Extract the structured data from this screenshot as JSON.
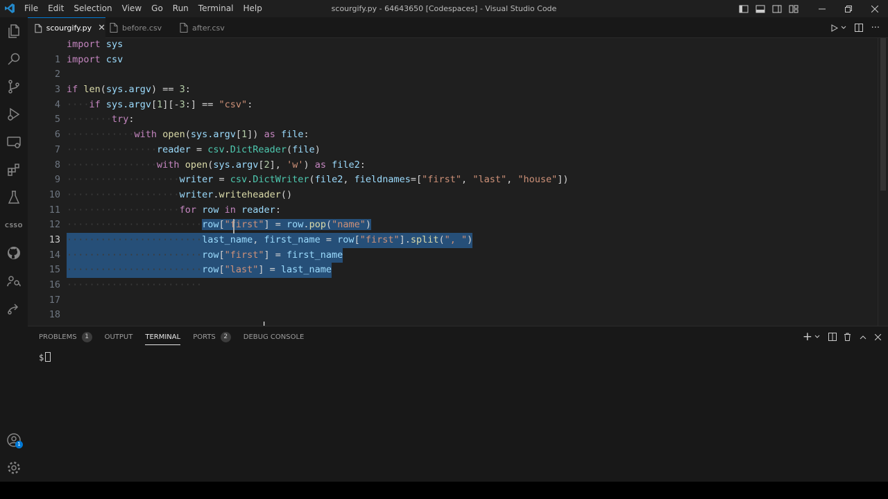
{
  "titlebar": {
    "menu": [
      "File",
      "Edit",
      "Selection",
      "View",
      "Go",
      "Run",
      "Terminal",
      "Help"
    ],
    "window_title": "scourgify.py - 64643650 [Codespaces] - Visual Studio Code"
  },
  "tabs": [
    {
      "label": "scourgify.py",
      "active": true
    },
    {
      "label": "before.csv",
      "active": false
    },
    {
      "label": "after.csv",
      "active": false
    }
  ],
  "activity": {
    "csso_label": "CSSO",
    "accounts_badge": "1"
  },
  "editor": {
    "line_numbers": [
      "1",
      "2",
      "3",
      "4",
      "5",
      "6",
      "7",
      "8",
      "9",
      "10",
      "11",
      "12",
      "13",
      "14",
      "15",
      "16",
      "17",
      "18"
    ],
    "current_line": "13",
    "lines": {
      "l1": {
        "k": "import",
        "n": "sys"
      },
      "l2": {
        "k": "import",
        "n": "csv"
      },
      "l4": {
        "k": "if",
        "f": "len",
        "o": "(",
        "n": "sys.argv",
        "c": ") ==",
        "m": "3",
        "e": ":"
      },
      "l5": {
        "ws": "····",
        "k": "if",
        "n": "sys.argv",
        "a": "[",
        "m1": "1",
        "b": "][-",
        "m2": "3",
        "c": ":] ==",
        "s": "\"csv\"",
        "e": ":"
      },
      "l6": {
        "ws": "········",
        "k": "try",
        "e": ":"
      },
      "l7": {
        "ws": "············",
        "k": "with",
        "f": "open",
        "o": "(",
        "n": "sys.argv",
        "a": "[",
        "m": "1",
        "b": "])",
        "k2": "as",
        "n2": "file",
        "e": ":"
      },
      "l8": {
        "ws": "················",
        "n": "reader",
        "o": " = ",
        "n2": "csv",
        "d": ".",
        "c": "DictReader",
        "a": "(",
        "n3": "file",
        "e": ")"
      },
      "l9": {
        "ws": "················",
        "k": "with",
        "f": "open",
        "o": "(",
        "n": "sys.argv",
        "a": "[",
        "m": "2",
        "b": "], ",
        "s": "'w'",
        "c": ")",
        "k2": "as",
        "n2": "file2",
        "e": ":"
      },
      "l10": {
        "ws": "····················",
        "n": "writer",
        "o": " = ",
        "n2": "csv",
        "d": ".",
        "c": "DictWriter",
        "a": "(",
        "n3": "file2",
        "b": ", ",
        "n4": "fieldnames",
        "eq": "=[",
        "s1": "\"first\"",
        "x1": ", ",
        "s2": "\"last\"",
        "x2": ", ",
        "s3": "\"house\"",
        "e": "])"
      },
      "l11": {
        "ws": "····················",
        "n": "writer",
        "d": ".",
        "f": "writeheader",
        "e": "()"
      },
      "l12": {
        "ws": "····················",
        "k": "for",
        "n": "row",
        "k2": "in",
        "n2": "reader",
        "e": ":"
      },
      "l13": {
        "ws": "························",
        "n": "row",
        "a": "[",
        "s": "\"first\"",
        "b": "] = ",
        "n2": "row",
        "d": ".",
        "f": "pop",
        "o": "(",
        "s2": "\"name\"",
        "e": ")"
      },
      "l14": {
        "ws": "························",
        "n": "last_name",
        "x": ", ",
        "n2": "first_name",
        "o": " = ",
        "n3": "row",
        "a": "[",
        "s": "\"first\"",
        "b": "].",
        "f": "split",
        "c": "(",
        "s2": "\", \"",
        "e": ")"
      },
      "l15": {
        "ws": "························",
        "n": "row",
        "a": "[",
        "s": "\"first\"",
        "b": "] = ",
        "n2": "first_name"
      },
      "l16": {
        "ws": "························",
        "n": "row",
        "a": "[",
        "s": "\"last\"",
        "b": "] = ",
        "n2": "last_name"
      },
      "l17": {
        "ws": "························"
      }
    }
  },
  "panel": {
    "tabs": [
      {
        "label": "PROBLEMS",
        "count": "1"
      },
      {
        "label": "OUTPUT"
      },
      {
        "label": "TERMINAL",
        "active": true
      },
      {
        "label": "PORTS",
        "count": "2"
      },
      {
        "label": "DEBUG CONSOLE"
      }
    ],
    "terminal_prompt": "$"
  },
  "colors": {
    "accent": "#0078d4",
    "selection": "#264f78",
    "keyword": "#c586c0",
    "variable": "#9cdcfe",
    "function": "#dcdcaa",
    "string": "#ce9178",
    "number": "#b5cea8",
    "class": "#4ec9b0"
  }
}
